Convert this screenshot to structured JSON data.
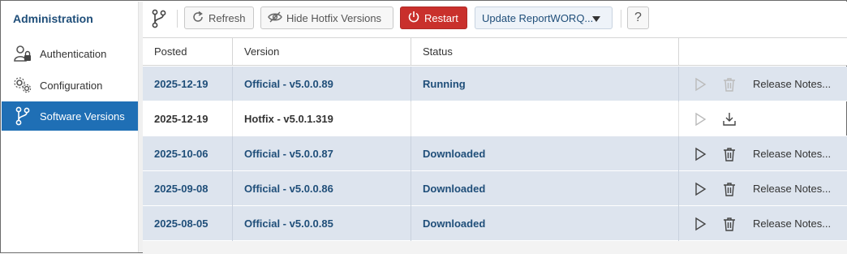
{
  "sidebar": {
    "title": "Administration",
    "items": [
      {
        "label": "Authentication",
        "icon": "user-lock-icon"
      },
      {
        "label": "Configuration",
        "icon": "gears-icon"
      },
      {
        "label": "Software Versions",
        "icon": "branch-icon",
        "active": true
      }
    ]
  },
  "toolbar": {
    "branch_icon": "branch-icon",
    "refresh_label": "Refresh",
    "hide_hotfix_label": "Hide Hotfix Versions",
    "restart_label": "Restart",
    "update_label": "Update ReportWORQ...",
    "help_label": "?"
  },
  "colors": {
    "accent": "#1f6fb5",
    "restart": "#c9302c",
    "row_shade": "#dde4ee",
    "text_link": "#1f4e79"
  },
  "table": {
    "columns": [
      "Posted",
      "Version",
      "Status",
      ""
    ],
    "rows": [
      {
        "posted": "2025-12-19",
        "version": "Official - v5.0.0.89",
        "status": "Running",
        "shaded": true,
        "actions": [
          "play-icon-disabled",
          "trash-icon-disabled"
        ],
        "release_notes": "Release Notes..."
      },
      {
        "posted": "2025-12-19",
        "version": "Hotfix - v5.0.1.319",
        "status": "",
        "shaded": false,
        "actions": [
          "play-icon-disabled",
          "download-icon"
        ],
        "release_notes": ""
      },
      {
        "posted": "2025-10-06",
        "version": "Official - v5.0.0.87",
        "status": "Downloaded",
        "shaded": true,
        "actions": [
          "play-icon",
          "trash-icon"
        ],
        "release_notes": "Release Notes..."
      },
      {
        "posted": "2025-09-08",
        "version": "Official - v5.0.0.86",
        "status": "Downloaded",
        "shaded": true,
        "actions": [
          "play-icon",
          "trash-icon"
        ],
        "release_notes": "Release Notes..."
      },
      {
        "posted": "2025-08-05",
        "version": "Official - v5.0.0.85",
        "status": "Downloaded",
        "shaded": true,
        "actions": [
          "play-icon",
          "trash-icon"
        ],
        "release_notes": "Release Notes..."
      }
    ]
  }
}
